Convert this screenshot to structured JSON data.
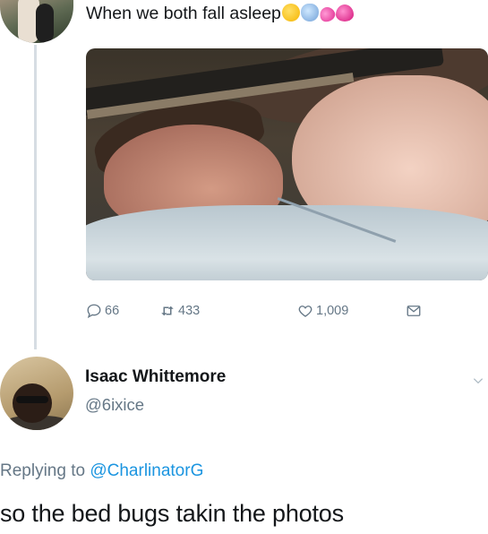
{
  "tweet": {
    "text": "When we both fall asleep",
    "emojis": [
      "sleepy-face",
      "screaming-face",
      "two-hearts",
      "sparkling-heart"
    ]
  },
  "stats": {
    "replies": "66",
    "retweets": "433",
    "likes": "1,009"
  },
  "reply": {
    "name": "Isaac Whittemore",
    "handle": "@6ixice",
    "replying_label": "Replying to",
    "replying_to": "@CharlinatorG",
    "text": "so the bed bugs takin the photos"
  },
  "colors": {
    "text": "#14171a",
    "muted": "#657786",
    "link": "#1b95e0",
    "thread_line": "#d6dde3"
  }
}
